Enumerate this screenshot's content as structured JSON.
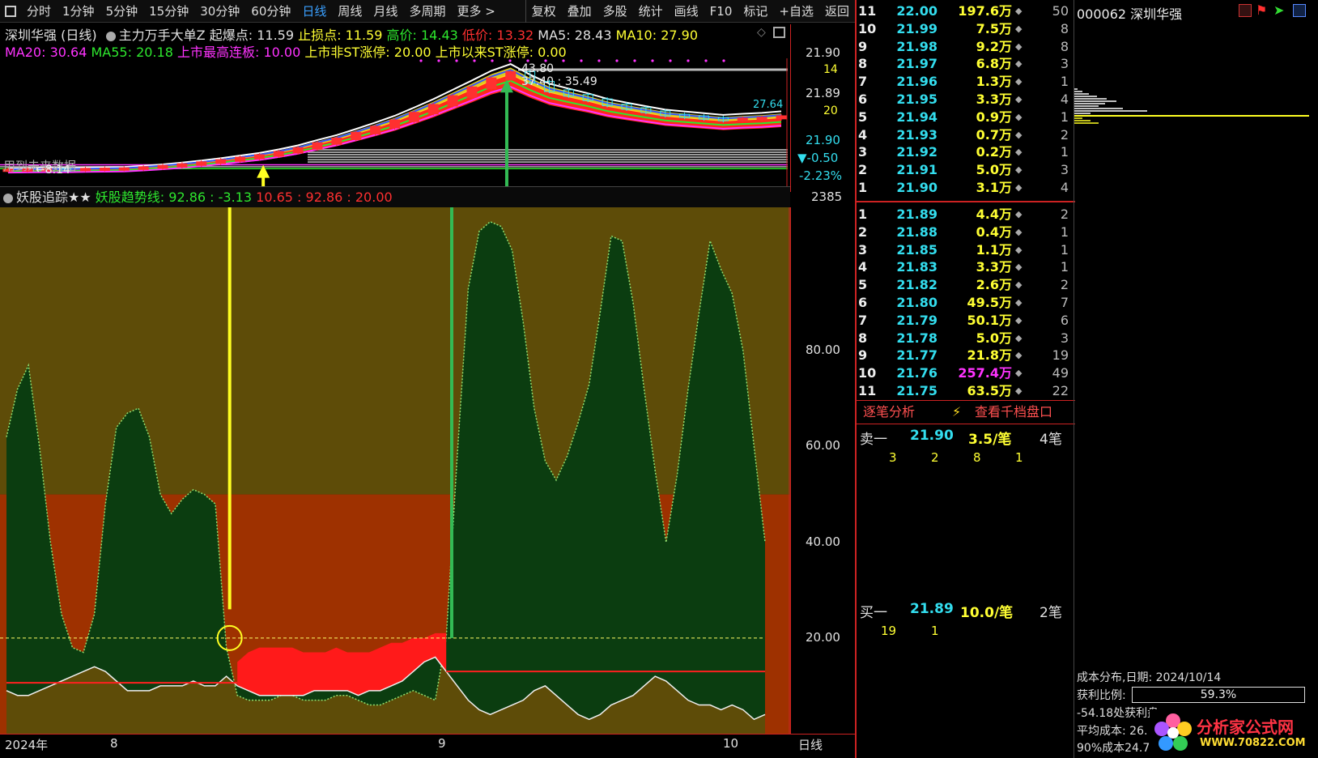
{
  "toolbar": {
    "left": [
      "分时",
      "1分钟",
      "5分钟",
      "15分钟",
      "30分钟",
      "60分钟",
      "日线",
      "周线",
      "月线",
      "多周期",
      "更多 >"
    ],
    "right": [
      "复权",
      "叠加",
      "多股",
      "统计",
      "画线",
      "F10",
      "标记",
      "+自选",
      "返回"
    ]
  },
  "header": {
    "stock": "深圳华强 (日线)",
    "indicator": "主力万手大单Z",
    "qbd_label": "起爆点: 11.59",
    "zsd_label": "止损点: 11.59",
    "high_label": "高价: 14.43",
    "low_label": "低价: 13.32",
    "ma5_label": "MA5: 28.43",
    "ma10_label": "MA10: 27.90",
    "ma20_label": "MA20: 30.64",
    "ma55_label": "MA55: 20.18",
    "ss_label": "上市最高连板: 10.00",
    "st1_label": "上市非ST涨停: 20.00",
    "st2_label": "上市以来ST涨停: 0.00"
  },
  "price_axis": {
    "v1": "21.90",
    "v2": "14",
    "v3": "21.89",
    "v4": "20",
    "v5": "21.90",
    "v6": "▼-0.50",
    "v7": "-2.23%"
  },
  "price_panel": {
    "left_note": "用到未来数据",
    "low_mark": "←8.14",
    "hi_mark": "43.80",
    "ma_mark": "37.40 : 35.49",
    "right_mark": "27.64"
  },
  "lower_header": {
    "name": "妖股追踪★★",
    "line_label": "妖股趋势线: 92.86 : -3.13",
    "vals": "10.65 : 92.86 : 20.00",
    "right_num": "2385"
  },
  "lower_axis": {
    "ticks": [
      "80.00",
      "60.00",
      "40.00",
      "20.00"
    ]
  },
  "date_axis": {
    "year": "2024年",
    "m8": "8",
    "m9": "9",
    "m10": "10",
    "period": "日线"
  },
  "colors": {
    "up": "#ff3030",
    "down": "#33ddee",
    "band_red": "#9e3100",
    "band_olive": "#5e4c08",
    "area_green": "#0b3d10",
    "cyan": "#33ddee",
    "yellow": "#ffff33",
    "magenta": "#ff33ff",
    "green": "#2ee82e"
  },
  "orderbook": {
    "sell": [
      {
        "lvl": "11",
        "price": "22.00",
        "vol": "197.6万",
        "cnt": "50"
      },
      {
        "lvl": "10",
        "price": "21.99",
        "vol": "7.5万",
        "cnt": "8"
      },
      {
        "lvl": "9",
        "price": "21.98",
        "vol": "9.2万",
        "cnt": "8"
      },
      {
        "lvl": "8",
        "price": "21.97",
        "vol": "6.8万",
        "cnt": "3"
      },
      {
        "lvl": "7",
        "price": "21.96",
        "vol": "1.3万",
        "cnt": "1"
      },
      {
        "lvl": "6",
        "price": "21.95",
        "vol": "3.3万",
        "cnt": "4"
      },
      {
        "lvl": "5",
        "price": "21.94",
        "vol": "0.9万",
        "cnt": "1"
      },
      {
        "lvl": "4",
        "price": "21.93",
        "vol": "0.7万",
        "cnt": "2"
      },
      {
        "lvl": "3",
        "price": "21.92",
        "vol": "0.2万",
        "cnt": "1"
      },
      {
        "lvl": "2",
        "price": "21.91",
        "vol": "5.0万",
        "cnt": "3"
      },
      {
        "lvl": "1",
        "price": "21.90",
        "vol": "3.1万",
        "cnt": "4"
      }
    ],
    "buy": [
      {
        "lvl": "1",
        "price": "21.89",
        "vol": "4.4万",
        "cnt": "2"
      },
      {
        "lvl": "2",
        "price": "21.88",
        "vol": "0.4万",
        "cnt": "1"
      },
      {
        "lvl": "3",
        "price": "21.85",
        "vol": "1.1万",
        "cnt": "1"
      },
      {
        "lvl": "4",
        "price": "21.83",
        "vol": "3.3万",
        "cnt": "1"
      },
      {
        "lvl": "5",
        "price": "21.82",
        "vol": "2.6万",
        "cnt": "2"
      },
      {
        "lvl": "6",
        "price": "21.80",
        "vol": "49.5万",
        "cnt": "7"
      },
      {
        "lvl": "7",
        "price": "21.79",
        "vol": "50.1万",
        "cnt": "6"
      },
      {
        "lvl": "8",
        "price": "21.78",
        "vol": "5.0万",
        "cnt": "3"
      },
      {
        "lvl": "9",
        "price": "21.77",
        "vol": "21.8万",
        "cnt": "19"
      },
      {
        "lvl": "10",
        "price": "21.76",
        "vol": "257.4万",
        "cnt": "49"
      },
      {
        "lvl": "11",
        "price": "21.75",
        "vol": "63.5万",
        "cnt": "22"
      }
    ]
  },
  "trades": {
    "tab1": "逐笔分析",
    "tab2": "查看千档盘口",
    "sell1_label": "卖一",
    "sell1_price": "21.90",
    "sell1_per": "3.5/笔",
    "sell1_n": "4笔",
    "sell1_nums": [
      "3",
      "2",
      "8",
      "1"
    ],
    "buy1_label": "买一",
    "buy1_price": "21.89",
    "buy1_per": "10.0/笔",
    "buy1_n": "2笔",
    "buy1_nums": [
      "19",
      "1"
    ]
  },
  "side": {
    "code": "000062 深圳华强",
    "cost_title": "成本分布,日期: 2024/10/14",
    "profit_label": "获利比例:",
    "profit_value": "59.3%",
    "profit_pct": 59.3,
    "line3": "-54.18处获利盘:",
    "line4": "平均成本: 26.",
    "line5": "90%成本24.7",
    "logo_text": "分析家公式网",
    "logo_url": "WWW.70822.COM"
  },
  "chart_data": [
    {
      "type": "candlestick",
      "title": "深圳华强 (日线)",
      "note": "upper price panel; values approximate",
      "closes": [
        8.14,
        8.2,
        8.3,
        8.25,
        8.4,
        8.5,
        8.6,
        9.0,
        9.5,
        10.1,
        10.8,
        11.6,
        12.5,
        13.4,
        14.6,
        16.0,
        17.8,
        19.5,
        21.6,
        23.8,
        26.1,
        28.9,
        31.8,
        35.0,
        38.2,
        41.5,
        43.8,
        40.2,
        37.1,
        35.4,
        33.8,
        31.9,
        30.6,
        29.4,
        28.2,
        27.6,
        27.0,
        26.4,
        26.8,
        27.1,
        27.64
      ],
      "series": [
        {
          "name": "MA5",
          "value": 28.43
        },
        {
          "name": "MA10",
          "value": 27.9
        },
        {
          "name": "MA20",
          "value": 30.64
        },
        {
          "name": "MA55",
          "value": 20.18
        }
      ],
      "annotations": [
        "43.80",
        "37.40 : 35.49",
        "←8.14",
        "27.64"
      ]
    },
    {
      "type": "area",
      "title": "妖股追踪★★",
      "ylim": [
        0,
        110
      ],
      "yticks": [
        20,
        40,
        60,
        80
      ],
      "reference_line": 20,
      "band_red_range": [
        0,
        50
      ],
      "band_olive_range": [
        50,
        110
      ],
      "x": [
        0,
        1,
        2,
        3,
        4,
        5,
        6,
        7,
        8,
        9,
        10,
        11,
        12,
        13,
        14,
        15,
        16,
        17,
        18,
        19,
        20,
        21,
        22,
        23,
        24,
        25,
        26,
        27,
        28,
        29,
        30,
        31,
        32,
        33,
        34,
        35,
        36,
        37,
        38,
        39,
        40,
        41,
        42,
        43,
        44,
        45,
        46,
        47,
        48,
        49,
        50,
        51,
        52,
        53,
        54,
        55,
        56,
        57,
        58,
        59,
        60,
        61,
        62,
        63,
        64,
        65,
        66,
        67,
        68,
        69
      ],
      "trend_line": [
        62,
        72,
        77,
        60,
        40,
        25,
        18,
        17,
        25,
        48,
        64,
        67,
        68,
        62,
        50,
        46,
        49,
        51,
        50,
        48,
        18,
        8,
        7,
        7,
        7,
        8,
        8,
        7,
        7,
        7,
        8,
        8,
        7,
        6,
        6,
        7,
        8,
        9,
        8,
        7,
        20,
        58,
        93,
        105,
        107,
        106,
        101,
        86,
        68,
        57,
        53,
        58,
        65,
        73,
        88,
        104,
        103,
        90,
        72,
        55,
        40,
        54,
        72,
        88,
        103,
        97,
        92,
        80,
        60,
        40
      ],
      "white_line": [
        9,
        8,
        8,
        9,
        10,
        11,
        12,
        13,
        14,
        13,
        11,
        9,
        9,
        9,
        10,
        10,
        10,
        11,
        10,
        10,
        12,
        10,
        9,
        8,
        8,
        8,
        8,
        8,
        9,
        9,
        9,
        9,
        8,
        9,
        9,
        10,
        11,
        13,
        15,
        16,
        13,
        10,
        7,
        5,
        4,
        5,
        6,
        7,
        9,
        10,
        8,
        6,
        4,
        3,
        4,
        6,
        7,
        8,
        10,
        12,
        11,
        9,
        7,
        6,
        6,
        5,
        6,
        5,
        3,
        4
      ],
      "red_area": [
        {
          "x": 21,
          "top": 15
        },
        {
          "x": 22,
          "top": 17
        },
        {
          "x": 23,
          "top": 18
        },
        {
          "x": 24,
          "top": 18
        },
        {
          "x": 25,
          "top": 18
        },
        {
          "x": 26,
          "top": 18
        },
        {
          "x": 27,
          "top": 17
        },
        {
          "x": 28,
          "top": 17
        },
        {
          "x": 29,
          "top": 17
        },
        {
          "x": 30,
          "top": 18
        },
        {
          "x": 31,
          "top": 17
        },
        {
          "x": 32,
          "top": 17
        },
        {
          "x": 33,
          "top": 17
        },
        {
          "x": 34,
          "top": 18
        },
        {
          "x": 35,
          "top": 19
        },
        {
          "x": 36,
          "top": 19
        },
        {
          "x": 37,
          "top": 20
        },
        {
          "x": 38,
          "top": 20
        },
        {
          "x": 39,
          "top": 21
        },
        {
          "x": 40,
          "top": 21
        }
      ],
      "red_level_left": 10.65,
      "red_level_right": 13
    }
  ]
}
